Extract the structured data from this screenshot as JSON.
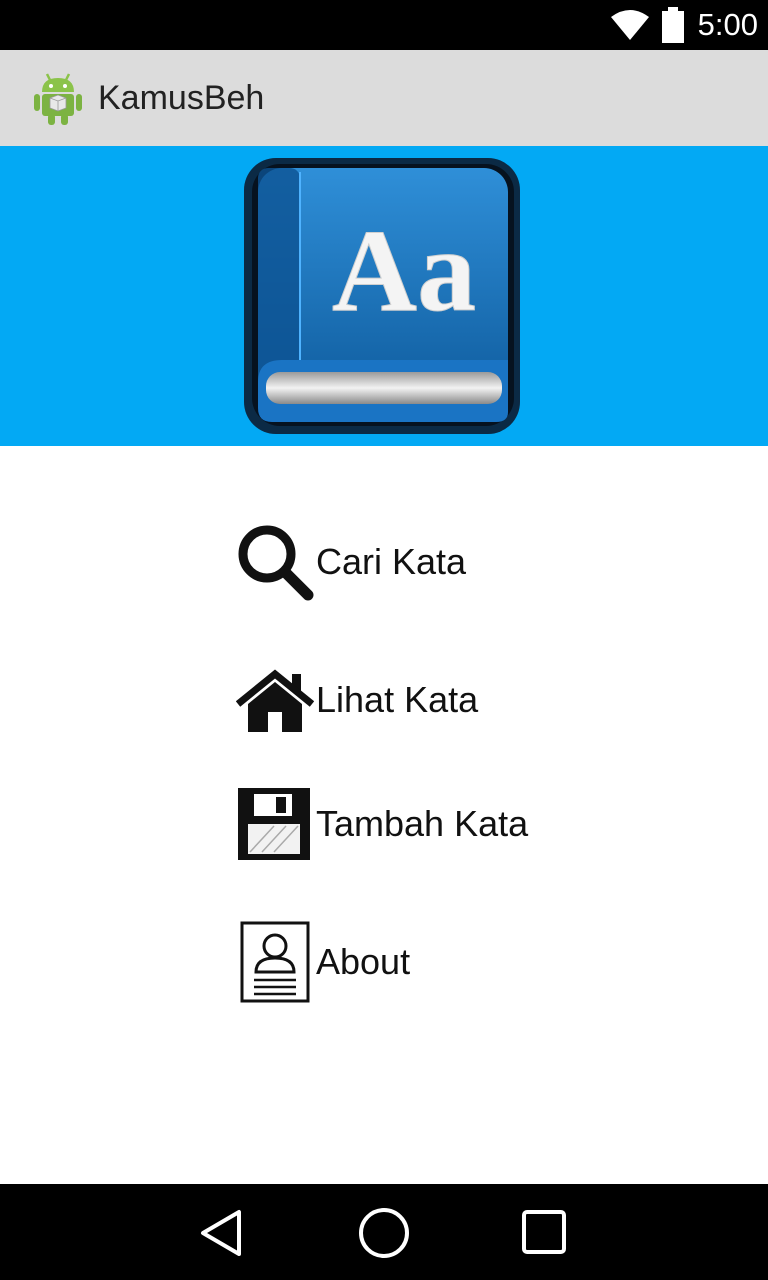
{
  "status_bar": {
    "time": "5:00",
    "icons": [
      "wifi-icon",
      "battery-icon"
    ]
  },
  "action_bar": {
    "app_icon": "android-icon",
    "title": "KamusBeh"
  },
  "banner": {
    "logo_icon": "dictionary-book-icon",
    "logo_text": "Aa",
    "background_color": "#03a9f4"
  },
  "menu": {
    "items": [
      {
        "icon": "magnifier-icon",
        "label": "Cari Kata"
      },
      {
        "icon": "house-icon",
        "label": "Lihat Kata"
      },
      {
        "icon": "floppy-disk-icon",
        "label": "Tambah Kata"
      },
      {
        "icon": "profile-card-icon",
        "label": "About"
      }
    ]
  },
  "nav_bar": {
    "buttons": [
      "back-icon",
      "home-icon",
      "recents-icon"
    ]
  }
}
